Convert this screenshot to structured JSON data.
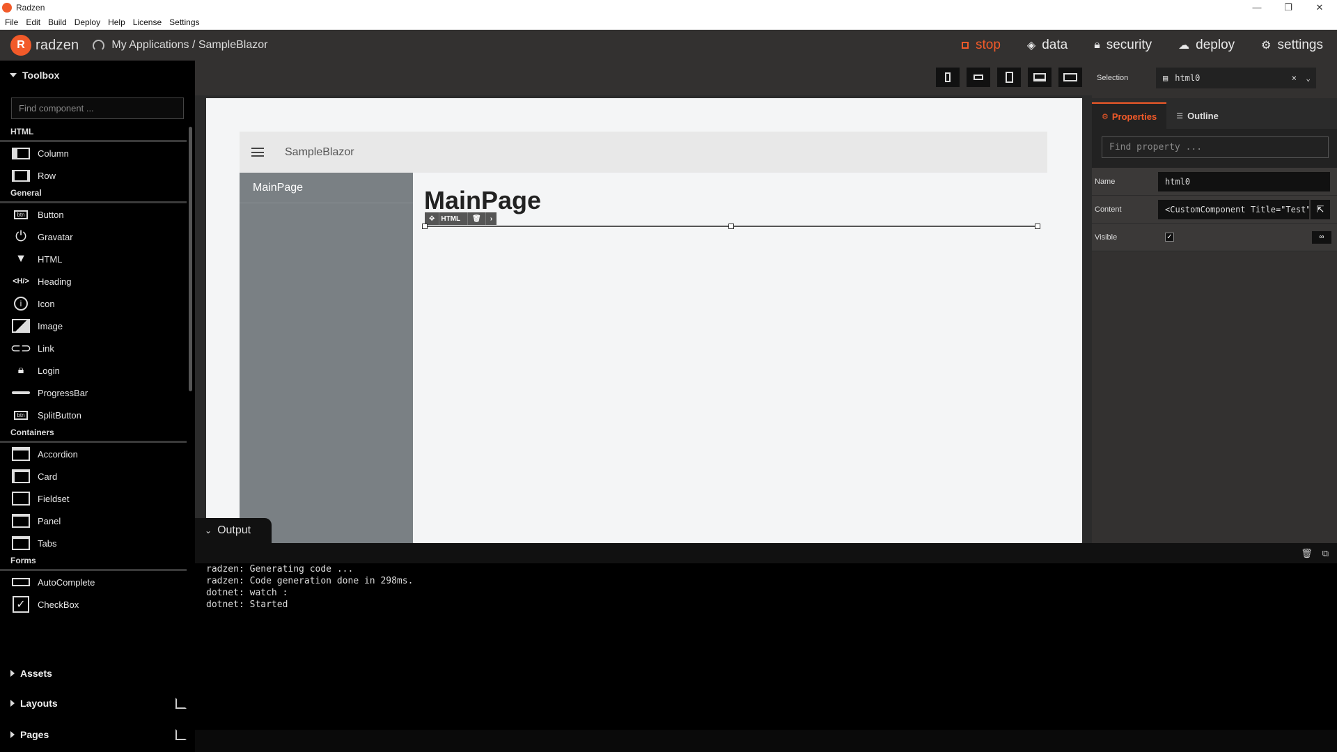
{
  "window": {
    "title": "Radzen"
  },
  "menu": [
    "File",
    "Edit",
    "Build",
    "Deploy",
    "Help",
    "License",
    "Settings"
  ],
  "header": {
    "logo_text": "radzen",
    "breadcrumb": "My Applications / SampleBlazor",
    "nav": {
      "stop": "stop",
      "data": "data",
      "security": "security",
      "deploy": "deploy",
      "settings": "settings"
    }
  },
  "toolbox": {
    "title": "Toolbox",
    "search_placeholder": "Find component ...",
    "categories": [
      {
        "name": "HTML",
        "items": [
          "Column",
          "Row"
        ]
      },
      {
        "name": "General",
        "items": [
          "Button",
          "Gravatar",
          "HTML",
          "Heading",
          "Icon",
          "Image",
          "Link",
          "Login",
          "ProgressBar",
          "SplitButton"
        ]
      },
      {
        "name": "Containers",
        "items": [
          "Accordion",
          "Card",
          "Fieldset",
          "Panel",
          "Tabs"
        ]
      },
      {
        "name": "Forms",
        "items": [
          "AutoComplete",
          "CheckBox"
        ]
      }
    ],
    "icon_labels": {
      "btn": "btn",
      "heading": "<H/>"
    },
    "sections": {
      "assets": "Assets",
      "layouts": "Layouts",
      "pages": "Pages"
    }
  },
  "canvas": {
    "app_name": "SampleBlazor",
    "nav_item": "MainPage",
    "heading": "MainPage",
    "selection_tag": "HTML"
  },
  "properties": {
    "selection_label": "Selection",
    "selection_value": "html0",
    "tabs": {
      "properties": "Properties",
      "outline": "Outline"
    },
    "find_placeholder": "Find property ...",
    "rows": {
      "name_label": "Name",
      "name_value": "html0",
      "content_label": "Content",
      "content_value": "<CustomComponent Title=\"Test\"",
      "visible_label": "Visible"
    }
  },
  "output": {
    "title": "Output",
    "lines": [
      "radzen: Generating code ...",
      "radzen: Code generation done in 298ms.",
      "dotnet: watch :",
      "dotnet: Started"
    ]
  }
}
